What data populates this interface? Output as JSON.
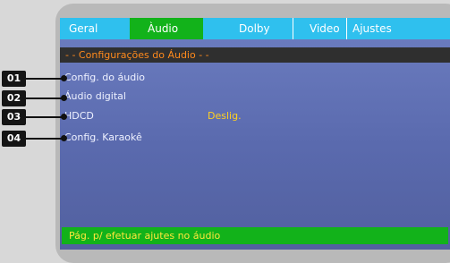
{
  "tabs": [
    {
      "label": "Geral",
      "active": false
    },
    {
      "label": "Àudio",
      "active": true
    },
    {
      "label": "Dolby",
      "active": false
    },
    {
      "label": "Video",
      "active": false
    },
    {
      "label": "Ajustes",
      "active": false
    }
  ],
  "header": "- -  Configurações  do  Áudio  - -",
  "menu": [
    {
      "label": "Config.  do  áudio"
    },
    {
      "label": "Áudio  digital"
    },
    {
      "label": "HDCD",
      "value": "Deslig."
    },
    {
      "label": "Config.  Karaokê"
    }
  ],
  "footer": "Pág.  p/  efetuar  ajutes  no  áudio",
  "callouts": [
    "01",
    "02",
    "03",
    "04"
  ],
  "colors": {
    "tab_bar": "#2fc0ee",
    "tab_active": "#12b21a",
    "header_text": "#ff8a1c",
    "value_text": "#ffd020",
    "footer_bg": "#12b21a",
    "footer_text": "#ffe73a",
    "screen_bg": "#6d7ec1"
  }
}
